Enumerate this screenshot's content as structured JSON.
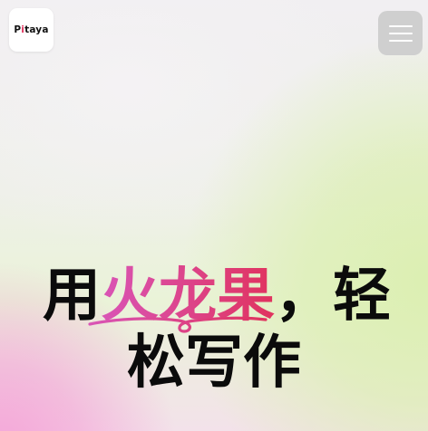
{
  "header": {
    "logo": {
      "text_before": "P",
      "text_accent": "i",
      "text_after": "taya",
      "accent_color": "#e0335e"
    },
    "menu_button": {
      "icon": "hamburger-menu-icon"
    }
  },
  "hero": {
    "line1_before": "用",
    "line1_highlight": "火龙果",
    "line1_after": "，轻",
    "line2": "松写作",
    "highlight_colors": [
      "#d955b6",
      "#e0335e"
    ],
    "underline_colors": [
      "#d955b6",
      "#e0335e"
    ]
  }
}
